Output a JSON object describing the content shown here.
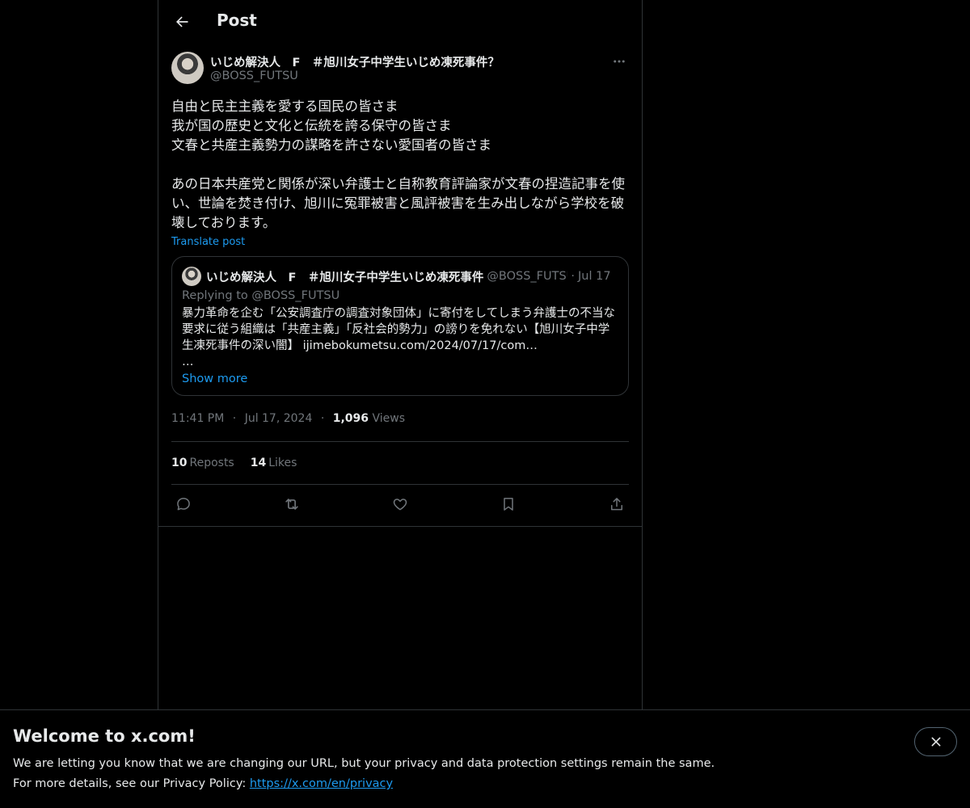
{
  "header": {
    "title": "Post"
  },
  "post": {
    "author_name": "いじめ解決人　F　＃旭川女子中学生いじめ凍死事件？",
    "author_handle": "@BOSS_FUTSU",
    "text": "自由と民主主義を愛する国民の皆さま\n我が国の歴史と文化と伝統を誇る保守の皆さま\n文春と共産主義勢力の謀略を許さない愛国者の皆さま\n\nあの日本共産党と関係が深い弁護士と自称教育評論家が文春の捏造記事を使い、世論を焚き付け、旭川に冤罪被害と風評被害を生み出しながら学校を破壊しております。",
    "translate_label": "Translate post",
    "quote": {
      "author_name": "いじめ解決人　F　＃旭川女子中学生いじめ凍死事件",
      "author_handle": "@BOSS_FUTSU",
      "date": "Jul 17",
      "replying_to": "Replying to @BOSS_FUTSU",
      "text": "暴力革命を企む「公安調査庁の調査対象団体」に寄付をしてしまう弁護士の不当な要求に従う組織は「共産主義」「反社会的勢力」の謗りを免れない【旭川女子中学生凍死事件の深い闇】 ijimebokumetsu.com/2024/07/17/com…\n…",
      "show_more": "Show more"
    },
    "time": "11:41 PM",
    "date": "Jul 17, 2024",
    "views_count": "1,096",
    "views_label": "Views",
    "reposts_count": "10",
    "reposts_label": "Reposts",
    "likes_count": "14",
    "likes_label": "Likes",
    "separator": "·"
  },
  "banner": {
    "title": "Welcome to x.com!",
    "line1": "We are letting you know that we are changing our URL, but your privacy and data protection settings remain the same.",
    "line2_prefix": "For more details, see our Privacy Policy: ",
    "link": "https://x.com/en/privacy"
  },
  "icons": {
    "back": "arrow-left-icon",
    "more": "more-horizontal-icon",
    "reply": "reply-icon",
    "repost": "repost-icon",
    "like": "heart-icon",
    "bookmark": "bookmark-icon",
    "share": "share-icon",
    "close": "close-icon"
  },
  "colors": {
    "background": "#000000",
    "text": "#e7e9ea",
    "muted": "#71767b",
    "accent": "#1d9bf0",
    "border": "#2f3336"
  }
}
